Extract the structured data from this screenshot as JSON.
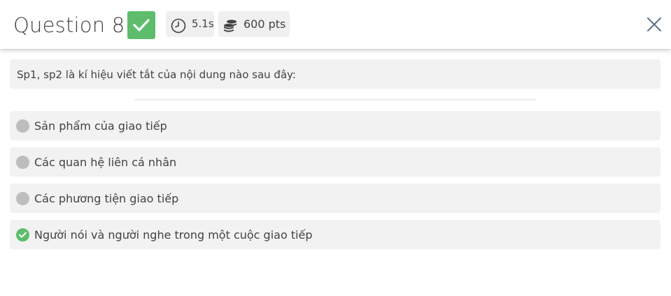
{
  "header": {
    "title": "Question 8",
    "status": "correct",
    "status_icon": "checkmark-icon",
    "time_icon": "clock-icon",
    "time": "5.1s",
    "points_icon": "coins-icon",
    "points": "600 pts",
    "close_icon": "close-icon"
  },
  "question": {
    "text": "Sp1, sp2 là kí hiệu viết tắt của nội dung nào sau đây:"
  },
  "options": [
    {
      "label": "Sản phẩm của giao tiếp",
      "correct": false
    },
    {
      "label": "Các quan hệ liên cá nhân",
      "correct": false
    },
    {
      "label": "Các phương tiện giao tiếp",
      "correct": false
    },
    {
      "label": "Người nói và người nghe trong một cuộc giao tiếp",
      "correct": true
    }
  ],
  "colors": {
    "correct_green": "#5ebd6c",
    "neutral_dot": "#bdbdbd",
    "panel_bg": "#f2f2f2",
    "text": "#424242"
  }
}
